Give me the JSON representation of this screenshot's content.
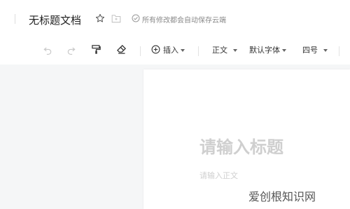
{
  "header": {
    "title": "无标题文档",
    "save_status": "所有修改都会自动保存云端"
  },
  "toolbar": {
    "insert_label": "插入",
    "style_label": "正文",
    "font_label": "默认字体",
    "size_label": "四号"
  },
  "editor": {
    "title_placeholder": "请输入标题",
    "body_placeholder": "请输入正文"
  },
  "watermark": {
    "text": "爱创根知识网"
  },
  "colors": {
    "placeholder": "#cfcfcf",
    "toolbar_icon": "#333333",
    "disabled_icon": "#c8c8c8"
  },
  "icons": {
    "star": "star-icon",
    "folder": "folder-icon",
    "saved": "check-circle-icon",
    "undo": "undo-icon",
    "redo": "redo-icon",
    "format_painter": "format-painter-icon",
    "eraser": "eraser-icon",
    "insert": "plus-circle-icon"
  }
}
